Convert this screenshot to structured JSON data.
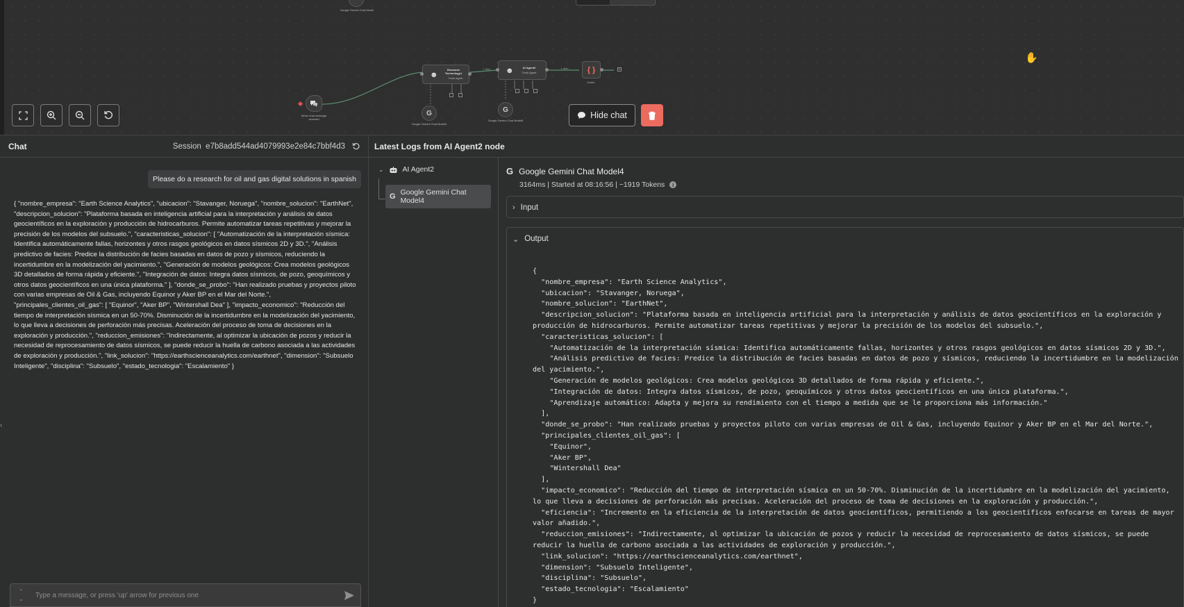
{
  "canvas": {
    "nodes": {
      "top_gemini": "Google Gemini Chat Model",
      "trigger": "When chat message received",
      "research": "Research Technology1",
      "research_sub": "Tools Agent",
      "gemini_left": "Google Gemini Chat Model4",
      "agent2": "AI Agent2",
      "agent2_sub": "Tools Agent",
      "gemini_right": "Google Gemini Chat Model5",
      "code": "Code1",
      "item_label_1": "1 item",
      "item_label_2": "1 item"
    },
    "controls": {
      "hide_chat": "Hide chat"
    }
  },
  "chat": {
    "title": "Chat",
    "session_label": "Session",
    "session_id": "e7b8add544ad4079993e2e84c7bbf4d3",
    "user_message": "Please do a research for oil and gas digital solutions in spanish",
    "bot_message": "{ \"nombre_empresa\": \"Earth Science Analytics\", \"ubicacion\": \"Stavanger, Noruega\", \"nombre_solucion\": \"EarthNet\", \"descripcion_solucion\": \"Plataforma basada en inteligencia artificial para la interpretación y análisis de datos geocientíficos en la exploración y producción de hidrocarburos. Permite automatizar tareas repetitivas y mejorar la precisión de los modelos del subsuelo.\", \"caracteristicas_solucion\": [ \"Automatización de la interpretación sísmica: Identifica automáticamente fallas, horizontes y otros rasgos geológicos en datos sísmicos 2D y 3D.\", \"Análisis predictivo de facies: Predice la distribución de facies basadas en datos de pozo y sísmicos, reduciendo la incertidumbre en la modelización del yacimiento.\", \"Generación de modelos geológicos: Crea modelos geológicos 3D detallados de forma rápida y eficiente.\", \"Integración de datos: Integra datos sísmicos, de pozo, geoquímicos y otros datos geocientíficos en una única plataforma.\" ], \"donde_se_probo\": \"Han realizado pruebas y proyectos piloto con varias empresas de Oil & Gas, incluyendo Equinor y Aker BP en el Mar del Norte.\", \"principales_clientes_oil_gas\": [ \"Equinor\", \"Aker BP\", \"Wintershall Dea\" ], \"impacto_economico\": \"Reducción del tiempo de interpretación sísmica en un 50-70%. Disminución de la incertidumbre en la modelización del yacimiento, lo que lleva a decisiones de perforación más precisas. Aceleración del proceso de toma de decisiones en la exploración y producción.\", \"reduccion_emisiones\": \"Indirectamente, al optimizar la ubicación de pozos y reducir la necesidad de reprocesamiento de datos sísmicos, se puede reducir la huella de carbono asociada a las actividades de exploración y producción.\", \"link_solucion\": \"https://earthscienceanalytics.com/earthnet\", \"dimension\": \"Subsuelo Inteligente\", \"disciplina\": \"Subsuelo\", \"estado_tecnologia\": \"Escalamiento\" }",
    "input_placeholder": "Type a message, or press 'up' arrow for previous one"
  },
  "logs": {
    "header": "Latest Logs from AI Agent2 node",
    "tree": {
      "root": "AI Agent2",
      "child": "Google Gemini Chat Model4"
    },
    "detail": {
      "title": "Google Gemini Chat Model4",
      "meta": "3164ms | Started at 08:16:56 | ~1919 Tokens",
      "input_label": "Input",
      "output_label": "Output",
      "output_json": "{\n  \"nombre_empresa\": \"Earth Science Analytics\",\n  \"ubicacion\": \"Stavanger, Noruega\",\n  \"nombre_solucion\": \"EarthNet\",\n  \"descripcion_solucion\": \"Plataforma basada en inteligencia artificial para la interpretación y análisis de datos geocientíficos en la exploración y producción de hidrocarburos. Permite automatizar tareas repetitivas y mejorar la precisión de los modelos del subsuelo.\",\n  \"caracteristicas_solucion\": [\n    \"Automatización de la interpretación sísmica: Identifica automáticamente fallas, horizontes y otros rasgos geológicos en datos sísmicos 2D y 3D.\",\n    \"Análisis predictivo de facies: Predice la distribución de facies basadas en datos de pozo y sísmicos, reduciendo la incertidumbre en la modelización del yacimiento.\",\n    \"Generación de modelos geológicos: Crea modelos geológicos 3D detallados de forma rápida y eficiente.\",\n    \"Integración de datos: Integra datos sísmicos, de pozo, geoquímicos y otros datos geocientíficos en una única plataforma.\",\n    \"Aprendizaje automático: Adapta y mejora su rendimiento con el tiempo a medida que se le proporciona más información.\"\n  ],\n  \"donde_se_probo\": \"Han realizado pruebas y proyectos piloto con varias empresas de Oil & Gas, incluyendo Equinor y Aker BP en el Mar del Norte.\",\n  \"principales_clientes_oil_gas\": [\n    \"Equinor\",\n    \"Aker BP\",\n    \"Wintershall Dea\"\n  ],\n  \"impacto_economico\": \"Reducción del tiempo de interpretación sísmica en un 50-70%. Disminución de la incertidumbre en la modelización del yacimiento, lo que lleva a decisiones de perforación más precisas. Aceleración del proceso de toma de decisiones en la exploración y producción.\",\n  \"eficiencia\": \"Incremento en la eficiencia de la interpretación de datos geocientíficos, permitiendo a los geocientíficos enfocarse en tareas de mayor valor añadido.\",\n  \"reduccion_emisiones\": \"Indirectamente, al optimizar la ubicación de pozos y reducir la necesidad de reprocesamiento de datos sísmicos, se puede reducir la huella de carbono asociada a las actividades de exploración y producción.\",\n  \"link_solucion\": \"https://earthscienceanalytics.com/earthnet\",\n  \"dimension\": \"Subsuelo Inteligente\",\n  \"disciplina\": \"Subsuelo\",\n  \"estado_tecnologia\": \"Escalamiento\"\n}"
    }
  },
  "icons": {
    "fit_view": "fit-view-icon",
    "zoom_in": "zoom-in-icon",
    "zoom_out": "zoom-out-icon",
    "reset": "reset-icon",
    "chat_bubble": "chat-bubble-icon",
    "trash": "trash-icon",
    "refresh": "refresh-icon",
    "send": "send-icon",
    "robot": "robot-icon",
    "google": "google-icon",
    "chevron_right": "chevron-right-icon",
    "chevron_down": "chevron-down-icon",
    "hand_cursor": "hand-cursor-icon",
    "info": "info-icon"
  },
  "colors": {
    "delete_accent": "#ec6b5f",
    "code_node_accent": "#ff6d5a",
    "connection_line": "#5c8f6e"
  }
}
